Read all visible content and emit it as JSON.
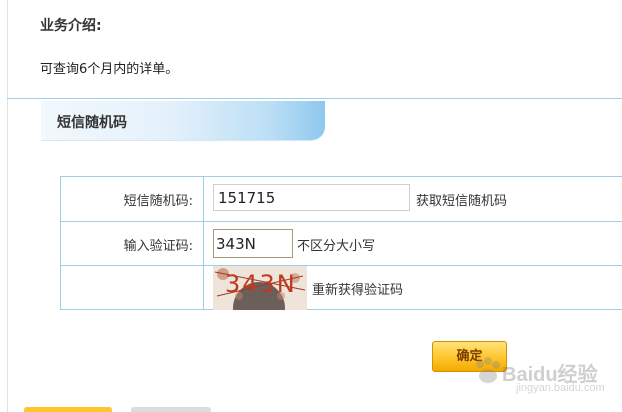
{
  "intro": {
    "title": "业务介绍:",
    "text": "可查询6个月内的详单。"
  },
  "section": {
    "title": "短信随机码"
  },
  "form": {
    "sms_code_label": "短信随机码:",
    "sms_code_value": "151715",
    "get_sms_code_link": "获取短信随机码",
    "captcha_label": "输入验证码:",
    "captcha_value": "343N",
    "case_note": "不区分大小写",
    "captcha_image_text": "343N",
    "refresh_captcha_link": "重新获得验证码"
  },
  "buttons": {
    "confirm_label": "确定"
  },
  "watermark": {
    "text": "Baidu经验",
    "sub": "jingyan.baidu.com"
  },
  "colors": {
    "accent_border": "#9ecde6",
    "button_orange": "#ffc52c"
  }
}
